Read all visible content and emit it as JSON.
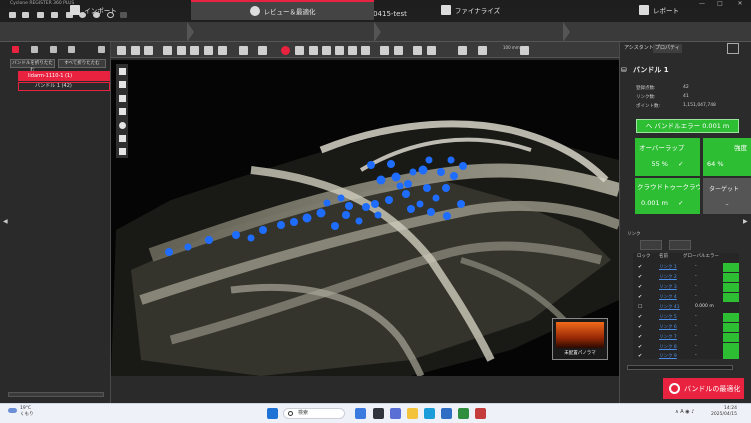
{
  "window": {
    "title": "Cyclone REGISTER 360 PLUS",
    "min": "—",
    "max": "□",
    "close": "✕"
  },
  "document": {
    "title": "0415-test"
  },
  "workflow": {
    "import": "インポート",
    "review": "レビュー＆最適化",
    "finalize": "ファイナライズ",
    "report": "レポート"
  },
  "left_panel": {
    "expand_all": "バンドルを折りたたむ",
    "collapse_all": "すべて折りたたむ",
    "tree_root": "lidarm-1110-1 (1)",
    "tree_child": "バンドル 1 (42)"
  },
  "toolbar": {
    "readout": "100 mm"
  },
  "viewport": {
    "thumbnail_label": "未配置パノラマ"
  },
  "right_panel": {
    "tab_assistant": "アシスタント",
    "tab_properties": "プロパティ",
    "bundle_title": "バンドル 1",
    "props": [
      {
        "label": "登録点数:",
        "value": "42"
      },
      {
        "label": "リンク数:",
        "value": "41"
      },
      {
        "label": "ポイント数:",
        "value": "1,151,047,748"
      }
    ],
    "bundle_error": {
      "label": "バンドルエラー",
      "value": "0.001 m"
    },
    "overlap": {
      "label": "オーバーラップ",
      "value": "55 %"
    },
    "strength": {
      "label": "強度",
      "value": "64 %"
    },
    "cloud_to_cloud": {
      "label": "クラウドトゥークラウド",
      "value": "0.001 m"
    },
    "target": {
      "label": "ターゲット"
    },
    "links_label": "リンク",
    "link_columns": [
      "ロック",
      "名前",
      "グローバルエラー"
    ],
    "links": [
      {
        "lock": "✔",
        "name": "リンク 1",
        "error": "-"
      },
      {
        "lock": "✔",
        "name": "リンク 2",
        "error": "-"
      },
      {
        "lock": "✔",
        "name": "リンク 3",
        "error": "-"
      },
      {
        "lock": "✔",
        "name": "リンク 4",
        "error": "-"
      },
      {
        "lock": "☐",
        "name": "リンク 41",
        "error": "0.000 m"
      },
      {
        "lock": "✔",
        "name": "リンク 5",
        "error": "-"
      },
      {
        "lock": "✔",
        "name": "リンク 6",
        "error": "-"
      },
      {
        "lock": "✔",
        "name": "リンク 7",
        "error": "-"
      },
      {
        "lock": "✔",
        "name": "リンク 8",
        "error": "-"
      },
      {
        "lock": "✔",
        "name": "リンク 9",
        "error": "-"
      }
    ],
    "optimize_button": "バンドルの最適化"
  },
  "taskbar": {
    "weather_temp": "19°C",
    "weather_desc": "くもり",
    "search_placeholder": "検索",
    "time": "14:24",
    "date": "2025/04/15"
  },
  "colors": {
    "accent_red": "#e8223f",
    "ok_green": "#2dbe34",
    "scan_blue": "#1f6dff"
  }
}
